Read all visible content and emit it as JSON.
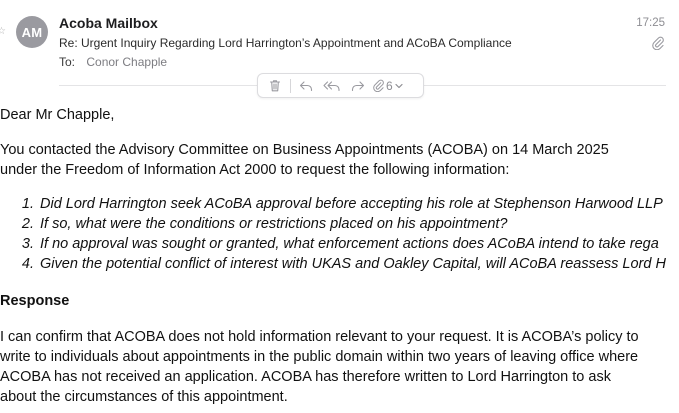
{
  "email": {
    "avatar_initials": "AM",
    "sender": "Acoba Mailbox",
    "subject": "Re: Urgent Inquiry Regarding Lord Harrington’s Appointment and ACoBA Compliance",
    "to_label": "To:",
    "to_value": "Conor Chapple",
    "time": "17:25",
    "attachment_count": "6"
  },
  "toolbar": {
    "icons": [
      "trash-icon",
      "reply-icon",
      "reply-all-icon",
      "forward-icon",
      "paperclip-icon"
    ]
  },
  "body": {
    "greeting": "Dear Mr Chapple,",
    "intro_lines": [
      "You contacted the Advisory Committee on Business Appointments (ACOBA) on 14 March 2025",
      "under the Freedom of Information Act 2000 to request the following information:"
    ],
    "questions": [
      {
        "num": "1.",
        "text": "Did Lord Harrington seek ACoBA approval before accepting his role at Stephenson Harwood LLP"
      },
      {
        "num": "2.",
        "text": "If so, what were the conditions or restrictions placed on his appointment?"
      },
      {
        "num": "3.",
        "text": "If no approval was sought or granted, what enforcement actions does ACoBA intend to take rega"
      },
      {
        "num": "4.",
        "text": "Given the potential conflict of interest with UKAS and Oakley Capital, will ACoBA reassess Lord H"
      }
    ],
    "response_heading": "Response",
    "response_lines": [
      "I can confirm that ACOBA does not hold information relevant to your request.  It is ACOBA’s policy to",
      "write to individuals about appointments in the public domain within two years of leaving office where",
      "ACOBA has not received an application.  ACOBA has therefore written to Lord Harrington to ask",
      "about the circumstances of this appointment."
    ]
  }
}
